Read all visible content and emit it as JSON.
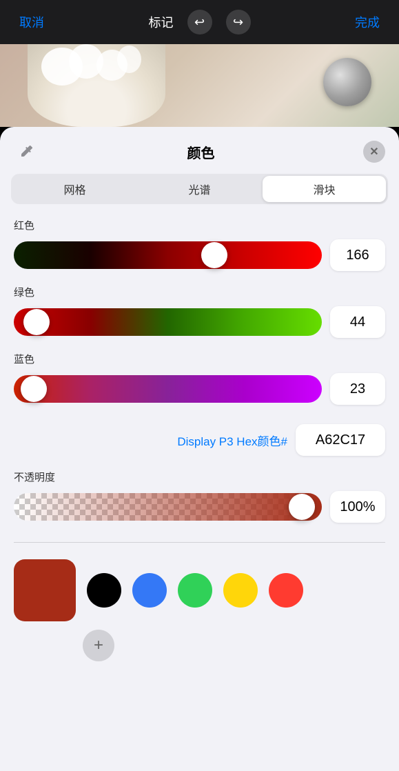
{
  "topbar": {
    "cancel_label": "取消",
    "title": "标记",
    "done_label": "完成"
  },
  "panel": {
    "title": "颜色",
    "eyedropper_icon": "💉",
    "close_icon": "✕",
    "segments": [
      "网格",
      "光谱",
      "滑块"
    ],
    "active_segment": 2
  },
  "sliders": {
    "red": {
      "label": "红色",
      "value": 166,
      "percent": 65
    },
    "green": {
      "label": "绿色",
      "value": 44,
      "percent": 17
    },
    "blue": {
      "label": "蓝色",
      "value": 23,
      "percent": 9
    }
  },
  "hex": {
    "label": "Display P3 Hex颜色#",
    "value": "A62C17"
  },
  "opacity": {
    "label": "不透明度",
    "value": "100%",
    "percent": 100
  },
  "swatches": {
    "current_color": "#a62c17",
    "presets": [
      {
        "color": "#000000",
        "name": "black"
      },
      {
        "color": "#3478f6",
        "name": "blue"
      },
      {
        "color": "#30d158",
        "name": "green"
      },
      {
        "color": "#ffd60a",
        "name": "yellow"
      },
      {
        "color": "#ff3b30",
        "name": "red"
      }
    ],
    "add_label": "+"
  }
}
